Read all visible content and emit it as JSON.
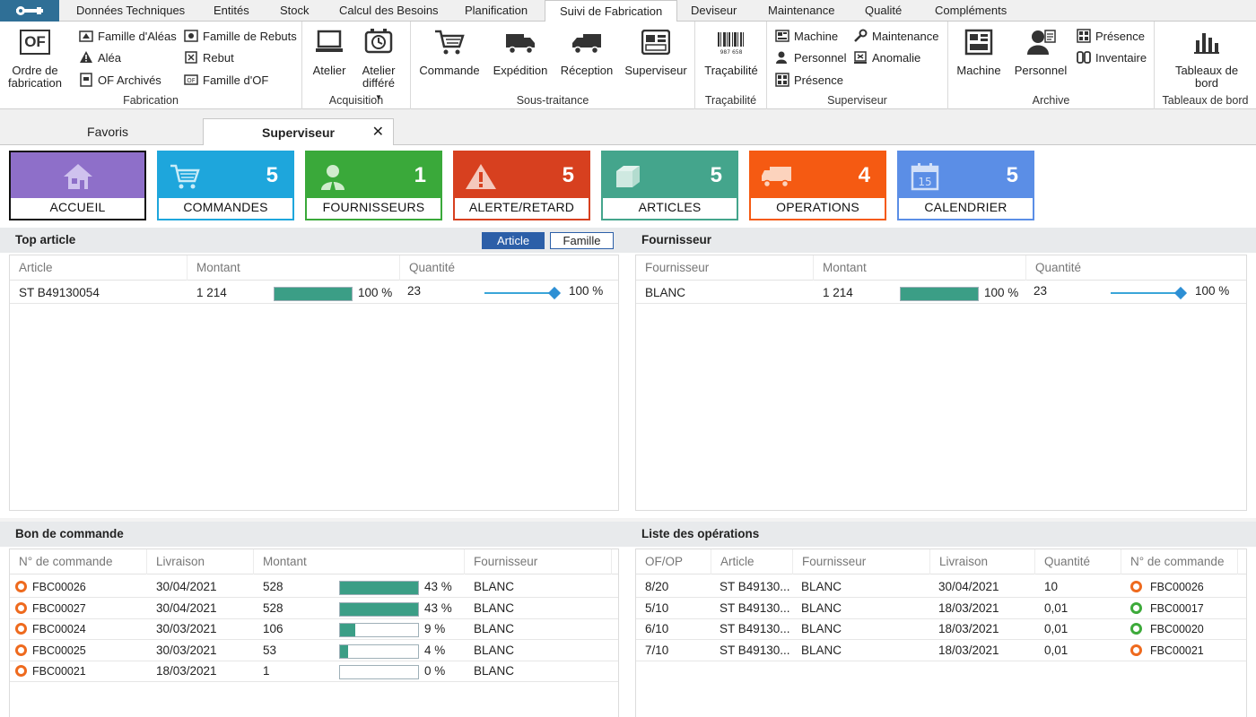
{
  "ribbon_tabs": [
    "Données Techniques",
    "Entités",
    "Stock",
    "Calcul des Besoins",
    "Planification",
    "Suivi de Fabrication",
    "Deviseur",
    "Maintenance",
    "Qualité",
    "Compléments"
  ],
  "active_ribbon_tab": "Suivi de Fabrication",
  "groups": {
    "fabrication": {
      "title": "Fabrication",
      "big": [
        "Ordre de",
        "fabrication"
      ],
      "big_icon_text": "OF",
      "small": [
        "Famille d'Aléas",
        "Aléa",
        "OF Archivés",
        "Famille de Rebuts",
        "Rebut",
        "Famille d'OF"
      ]
    },
    "acquisition": {
      "title": "Acquisition",
      "atelier": "Atelier",
      "atelier_differe": [
        "Atelier",
        "différé"
      ]
    },
    "sous_traitance": {
      "title": "Sous-traitance",
      "items": [
        "Commande",
        "Expédition",
        "Réception",
        "Superviseur"
      ]
    },
    "tracabilite": {
      "title": "Traçabilité",
      "item": "Traçabilité",
      "barcode_text": "987 658"
    },
    "superviseur": {
      "title": "Superviseur",
      "items": [
        "Machine",
        "Personnel",
        "Présence",
        "Maintenance",
        "Anomalie"
      ]
    },
    "archive": {
      "title": "Archive",
      "machine": "Machine",
      "personnel": "Personnel",
      "small": [
        "Présence",
        "Inventaire"
      ]
    },
    "tableaux": {
      "title": "Tableaux de bord",
      "item": [
        "Tableaux de",
        "bord"
      ]
    }
  },
  "doc_tabs": {
    "favoris": "Favoris",
    "superviseur": "Superviseur",
    "close": "✕"
  },
  "tiles": [
    {
      "label": "ACCUEIL",
      "count": "",
      "color": "#8e6fc9"
    },
    {
      "label": "COMMANDES",
      "count": "5",
      "color": "#1ea6dc"
    },
    {
      "label": "FOURNISSEURS",
      "count": "1",
      "color": "#3aa93a"
    },
    {
      "label": "ALERTE/RETARD",
      "count": "5",
      "color": "#d7401f"
    },
    {
      "label": "ARTICLES",
      "count": "5",
      "color": "#44a58c"
    },
    {
      "label": "OPERATIONS",
      "count": "4",
      "color": "#f55a12"
    },
    {
      "label": "CALENDRIER",
      "count": "5",
      "color": "#5b8ee6"
    }
  ],
  "top_article": {
    "title": "Top article",
    "toggle": [
      "Article",
      "Famille"
    ],
    "headers": [
      "Article",
      "Montant",
      "Quantité"
    ],
    "rows": [
      {
        "article": "ST B49130054",
        "montant": "1 214",
        "montant_pct": "100 %",
        "montant_fill": 1.0,
        "quantite": "23",
        "quantite_pct": "100 %",
        "quantite_fill": 1.0
      }
    ]
  },
  "fournisseur": {
    "title": "Fournisseur",
    "headers": [
      "Fournisseur",
      "Montant",
      "Quantité"
    ],
    "rows": [
      {
        "fournisseur": "BLANC",
        "montant": "1 214",
        "montant_pct": "100 %",
        "montant_fill": 1.0,
        "quantite": "23",
        "quantite_pct": "100 %",
        "quantite_fill": 1.0
      }
    ]
  },
  "bon_commande": {
    "title": "Bon de commande",
    "headers": [
      "N° de commande",
      "Livraison",
      "Montant",
      "Fournisseur"
    ],
    "rows": [
      {
        "num": "FBC00026",
        "livraison": "30/04/2021",
        "montant": "528",
        "pct": "43 %",
        "fill": 1.0,
        "fournisseur": "BLANC",
        "status": "orange"
      },
      {
        "num": "FBC00027",
        "livraison": "30/04/2021",
        "montant": "528",
        "pct": "43 %",
        "fill": 1.0,
        "fournisseur": "BLANC",
        "status": "orange"
      },
      {
        "num": "FBC00024",
        "livraison": "30/03/2021",
        "montant": "106",
        "pct": "9 %",
        "fill": 0.2,
        "fournisseur": "BLANC",
        "status": "orange"
      },
      {
        "num": "FBC00025",
        "livraison": "30/03/2021",
        "montant": "53",
        "pct": "4 %",
        "fill": 0.1,
        "fournisseur": "BLANC",
        "status": "orange"
      },
      {
        "num": "FBC00021",
        "livraison": "18/03/2021",
        "montant": "1",
        "pct": "0 %",
        "fill": 0.0,
        "fournisseur": "BLANC",
        "status": "orange"
      }
    ]
  },
  "operations": {
    "title": "Liste des opérations",
    "headers": [
      "OF/OP",
      "Article",
      "Fournisseur",
      "Livraison",
      "Quantité",
      "N° de commande"
    ],
    "rows": [
      {
        "ofop": "8/20",
        "article": "ST B49130...",
        "fournisseur": "BLANC",
        "livraison": "30/04/2021",
        "quantite": "10",
        "num": "FBC00026",
        "status": "orange"
      },
      {
        "ofop": "5/10",
        "article": "ST B49130...",
        "fournisseur": "BLANC",
        "livraison": "18/03/2021",
        "quantite": "0,01",
        "num": "FBC00017",
        "status": "green"
      },
      {
        "ofop": "6/10",
        "article": "ST B49130...",
        "fournisseur": "BLANC",
        "livraison": "18/03/2021",
        "quantite": "0,01",
        "num": "FBC00020",
        "status": "green"
      },
      {
        "ofop": "7/10",
        "article": "ST B49130...",
        "fournisseur": "BLANC",
        "livraison": "18/03/2021",
        "quantite": "0,01",
        "num": "FBC00021",
        "status": "orange"
      }
    ]
  },
  "colors": {
    "bar_fill": "#3b9e86",
    "slider": "#3aa5d8",
    "status_orange": "#ee6a1e",
    "status_green": "#3daa3a",
    "toggle_active": "#2c5fa8"
  }
}
